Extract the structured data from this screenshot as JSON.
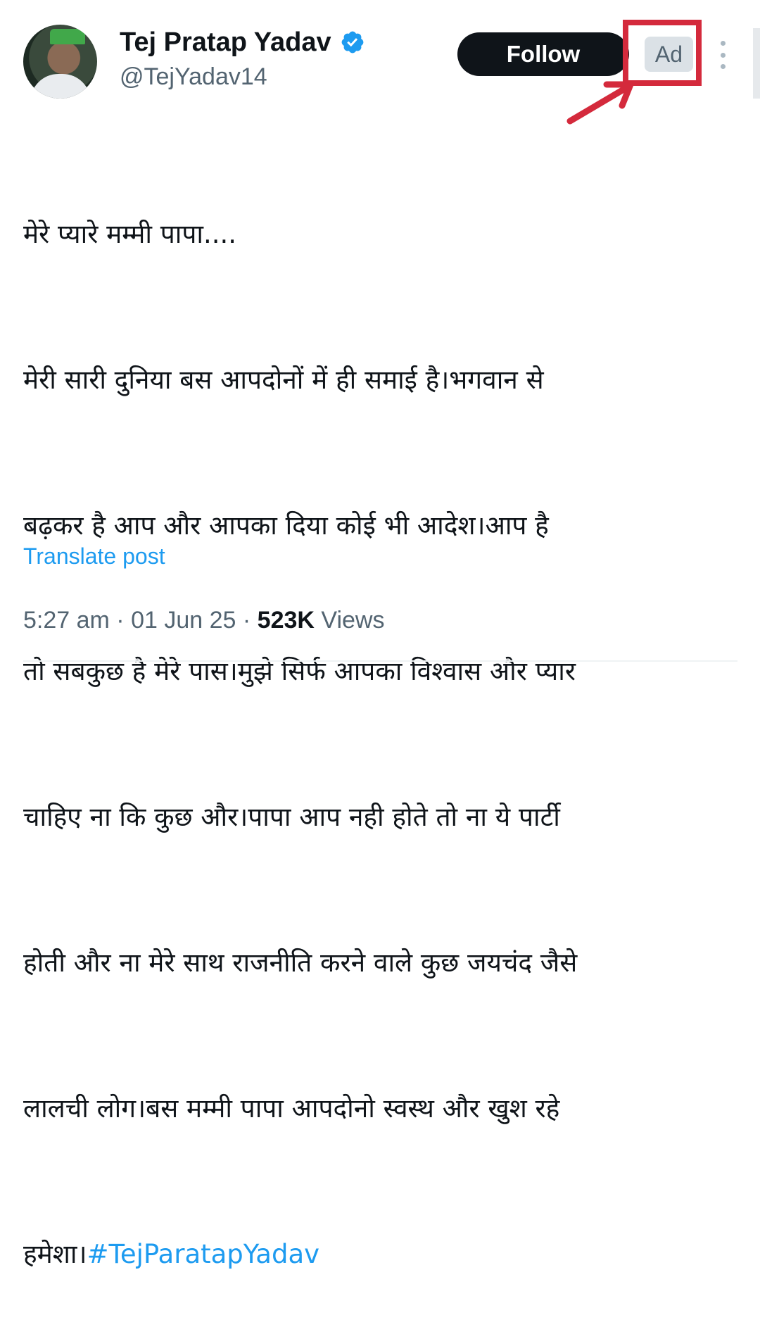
{
  "author": {
    "name": "Tej Pratap Yadav",
    "handle": "@TejYadav14",
    "verified": true,
    "verified_color": "#1d9bf0"
  },
  "actions": {
    "follow_label": "Follow",
    "ad_label": "Ad",
    "more_icon": "more-vertical-icon"
  },
  "post": {
    "lines": [
      "मेरे प्यारे मम्मी पापा....",
      "मेरी सारी दुनिया बस आपदोनों में ही समाई है।भगवान से",
      "बढ़कर है आप और आपका दिया कोई भी आदेश।आप है",
      "तो सबकुछ है मेरे पास।मुझे सिर्फ आपका विश्वास और प्यार",
      "चाहिए ना कि कुछ और।पापा आप नही होते तो ना ये पार्टी",
      "होती और ना मेरे साथ राजनीति करने वाले कुछ जयचंद जैसे",
      "लालची लोग।बस मम्मी पापा आपदोनो स्वस्थ और खुश रहे"
    ],
    "last_line_text": "हमेशा।",
    "hashtag": "#TejParatapYadav",
    "translate_label": "Translate post"
  },
  "meta": {
    "time": "5:27 am",
    "sep1": " · ",
    "date": "01 Jun 25",
    "sep2": " · ",
    "views_count": "523K",
    "views_label": " Views"
  },
  "colors": {
    "link": "#1d9bf0",
    "annotation": "#d42a3c",
    "text": "#0f1419",
    "muted": "#536471"
  }
}
